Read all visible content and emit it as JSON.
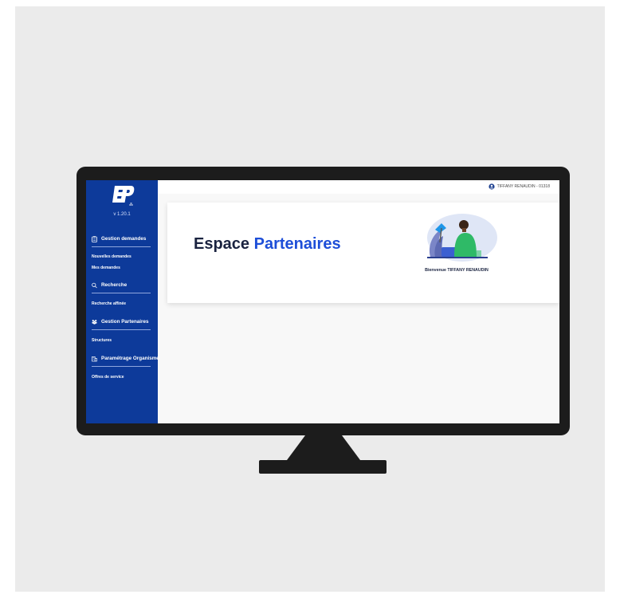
{
  "app": {
    "version": "v 1.20.1",
    "logo_icon": "ep-logo-icon"
  },
  "sidebar": {
    "sections": [
      {
        "label": "Gestion demandes",
        "icon": "clipboard-icon",
        "items": [
          "Nouvelles demandes",
          "Mes demandes"
        ]
      },
      {
        "label": "Recherche",
        "icon": "search-icon",
        "items": [
          "Recherche affinée"
        ]
      },
      {
        "label": "Gestion Partenaires",
        "icon": "group-icon",
        "items": [
          "Structures"
        ]
      },
      {
        "label": "Paramétrage Organisme",
        "icon": "building-icon",
        "items": [
          "Offres de service"
        ]
      }
    ]
  },
  "header": {
    "user": "TIFFANY RENAUDIN - 01318",
    "user_icon": "user-circle-icon"
  },
  "main": {
    "title_part1": "Espace",
    "title_part2": "Partenaires",
    "welcome": "Bienvenue TIFFANY RENAUDIN"
  },
  "colors": {
    "sidebar": "#0d3a9a",
    "accent": "#1d4ed8",
    "monitor": "#1c1c1c",
    "background": "#ebebeb"
  }
}
